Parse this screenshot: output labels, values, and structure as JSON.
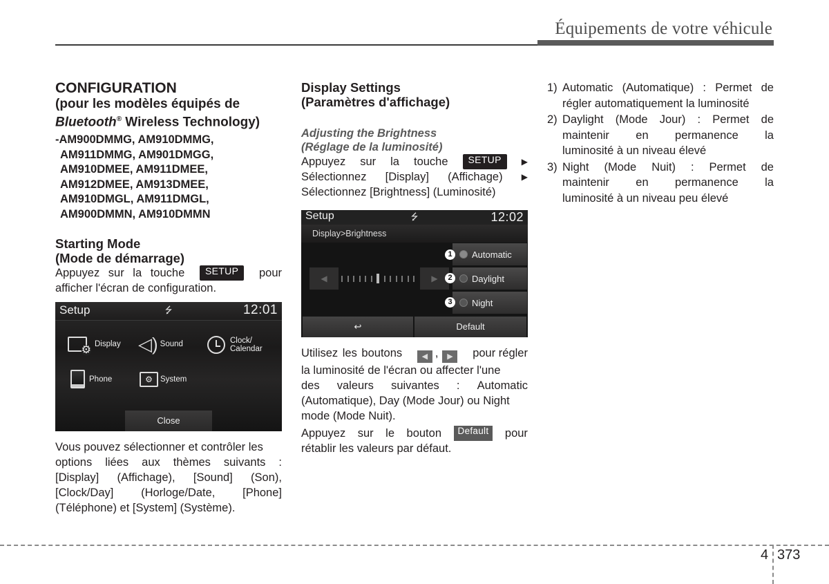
{
  "header": {
    "title": "Équipements de votre véhicule"
  },
  "col1": {
    "heading": "CONFIGURATION",
    "subheading_line1": "(pour les modèles équipés de",
    "subheading_bt": "Bluetooth",
    "subheading_reg": "®",
    "subheading_rest": " Wireless Technology)",
    "models": [
      "-AM900DMMG, AM910DMMG,",
      "AM911DMMG, AM901DMGG,",
      "AM910DMEE, AM911DMEE,",
      "AM912DMEE, AM913DMEE,",
      "AM910DMGL, AM911DMGL,",
      "AM900DMMN, AM910DMMN"
    ],
    "starting_mode_title": "Starting Mode",
    "starting_mode_subtitle": "(Mode de démarrage)",
    "starting_text_before": "Appuyez sur la touche",
    "setup_key": "SETUP",
    "starting_text_after": "pour",
    "starting_text_line2": "afficher l'écran de configuration.",
    "screen": {
      "title": "Setup",
      "usb_icon": "usb-icon",
      "time": "12:01",
      "items": [
        {
          "label": "Display",
          "icon": "display-settings-icon"
        },
        {
          "label": "Sound",
          "icon": "speaker-icon"
        },
        {
          "label_line1": "Clock/",
          "label_line2": "Calendar",
          "icon": "clock-icon"
        },
        {
          "label": "Phone",
          "icon": "phone-icon"
        },
        {
          "label": "System",
          "icon": "system-folder-icon"
        }
      ],
      "close": "Close"
    },
    "description_lines": [
      [
        "Vous pouvez sélectionner et contrôler les"
      ],
      [
        "options",
        "liées",
        "aux",
        "thèmes",
        "suivants",
        ":"
      ],
      [
        "[Display]",
        "(Affichage),",
        "[Sound]",
        "(Son),"
      ],
      [
        "[Clock/Day]",
        "(Horloge/Date,",
        "[Phone]"
      ],
      [
        "(Téléphone) et [System] (Système)."
      ]
    ]
  },
  "col2": {
    "heading_line1": "Display Settings",
    "heading_line2": "(Paramètres d'affichage)",
    "subheading_line1": "Adjusting the Brightness",
    "subheading_line2": "(Réglage de la luminosité)",
    "step1_words": [
      "Appuyez",
      "sur",
      "la",
      "touche"
    ],
    "setup_key": "SETUP",
    "step_arrow": "▶",
    "step2_words": [
      "Sélectionnez",
      "[Display]",
      "(Affichage)"
    ],
    "step3": "Sélectionnez [Brightness] (Luminosité)",
    "screen": {
      "title": "Setup",
      "time": "12:02",
      "breadcrumb": "Display>Brightness",
      "options": [
        {
          "num": "1",
          "label": "Automatic",
          "selected": true
        },
        {
          "num": "2",
          "label": "Daylight",
          "selected": false
        },
        {
          "num": "3",
          "label": "Night",
          "selected": false
        }
      ],
      "left_arrow": "◀",
      "right_arrow": "▶",
      "brightness_level": 6,
      "brightness_steps": 13,
      "back_icon": "↩",
      "default": "Default"
    },
    "para1": {
      "line1_before": "Utilisez les boutons",
      "left_btn": "◀",
      "sep": ",",
      "right_btn": "▶",
      "line1_after": "pour régler",
      "lines": [
        [
          "la luminosité de l'écran ou affecter l'une"
        ],
        [
          "des",
          "valeurs",
          "suivantes",
          ":",
          "Automatic"
        ],
        [
          "(Automatique), Day (Mode Jour) ou Night"
        ]
      ],
      "last_line": "mode (Mode Nuit)."
    },
    "para2": {
      "before_words": [
        "Appuyez",
        "sur",
        "le",
        "bouton"
      ],
      "default_key": "Default",
      "after": "pour",
      "line2": "rétablir les valeurs par défaut."
    }
  },
  "col3": {
    "items": [
      {
        "num": "1)",
        "lines": [
          [
            "Automatic",
            "(Automatique)",
            ":",
            "Permet",
            "de"
          ],
          [
            "régler automatiquement la luminosité"
          ]
        ]
      },
      {
        "num": "2)",
        "lines": [
          [
            "Daylight",
            "(Mode",
            "Jour)",
            ":",
            "Permet",
            "de"
          ],
          [
            "maintenir",
            "en",
            "permanence",
            "la"
          ],
          [
            "luminosité à un niveau élevé"
          ]
        ]
      },
      {
        "num": "3)",
        "lines": [
          [
            "Night",
            "(Mode",
            "Nuit)",
            ":",
            "Permet",
            "de"
          ],
          [
            "maintenir",
            "en",
            "permanence",
            "la"
          ],
          [
            "luminosité à un niveau peu élevé"
          ]
        ]
      }
    ]
  },
  "footer": {
    "chapter": "4",
    "page": "373"
  }
}
